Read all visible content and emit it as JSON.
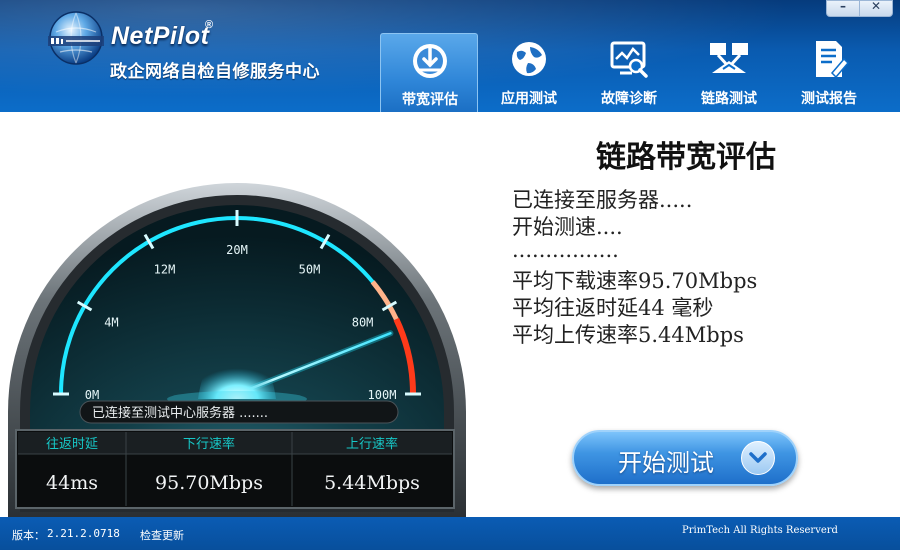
{
  "app": {
    "logo_name": "NetPilot",
    "logo_reg": "®",
    "subtitle": "政企网络自检自修服务中心"
  },
  "window": {
    "minimize": "–",
    "close": "✕"
  },
  "tabs": [
    {
      "label": "带宽评估",
      "icon": "bandwidth-icon",
      "active": true
    },
    {
      "label": "应用测试",
      "icon": "globe-icon",
      "active": false
    },
    {
      "label": "故障诊断",
      "icon": "diagnosis-icon",
      "active": false
    },
    {
      "label": "链路测试",
      "icon": "link-test-icon",
      "active": false
    },
    {
      "label": "测试报告",
      "icon": "report-icon",
      "active": false
    }
  ],
  "gauge": {
    "ticks": [
      "0M",
      "4M",
      "12M",
      "20M",
      "50M",
      "80M",
      "100M"
    ],
    "needle_level": 0.88,
    "status": "已连接至测试中心服务器 ......."
  },
  "stats": {
    "headers": [
      "往返时延",
      "下行速率",
      "上行速率"
    ],
    "values": [
      "44ms",
      "95.70Mbps",
      "5.44Mbps"
    ]
  },
  "info": {
    "title": "链路带宽评估",
    "lines": [
      "已连接至服务器.....",
      "开始测速....",
      "................",
      "平均下载速率95.70Mbps",
      "平均往返时延44 毫秒",
      "平均上传速率5.44Mbps"
    ]
  },
  "start_button": {
    "label": "开始测试"
  },
  "footer": {
    "version_label": "版本：",
    "version": "2.21.2.0718",
    "update_link": "检查更新",
    "copyright": "PrimTech All Rights Reserverd"
  },
  "colors": {
    "header_blue": "#0a5bb0",
    "gauge_cyan": "#1ee6ff",
    "gauge_red": "#ff3a1a",
    "stat_header": "#17c7c7"
  }
}
